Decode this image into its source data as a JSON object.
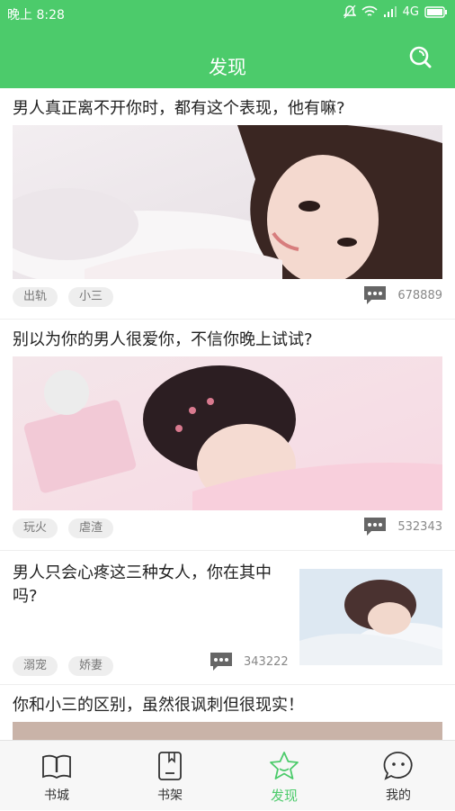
{
  "status": {
    "time": "晚上 8:28",
    "network": "4G"
  },
  "header": {
    "title": "发现"
  },
  "cards": [
    {
      "title": "男人真正离不开你时，都有这个表现，他有嘛?",
      "tags": [
        "出轨",
        "小三"
      ],
      "comments": "678889"
    },
    {
      "title": "别以为你的男人很爱你，不信你晚上试试?",
      "tags": [
        "玩火",
        "虐渣"
      ],
      "comments": "532343"
    },
    {
      "title": "男人只会心疼这三种女人，你在其中吗?",
      "tags": [
        "溺宠",
        "娇妻"
      ],
      "comments": "343222"
    },
    {
      "title": "你和小三的区别，虽然很讽刺但很现实！"
    }
  ],
  "tabs": [
    {
      "label": "书城",
      "icon": "book-open-icon"
    },
    {
      "label": "书架",
      "icon": "bookshelf-icon"
    },
    {
      "label": "发现",
      "icon": "star-icon",
      "active": true
    },
    {
      "label": "我的",
      "icon": "chat-bubble-icon"
    }
  ],
  "colors": {
    "accent": "#4ccb6b",
    "tag_bg": "#eeeeee"
  }
}
